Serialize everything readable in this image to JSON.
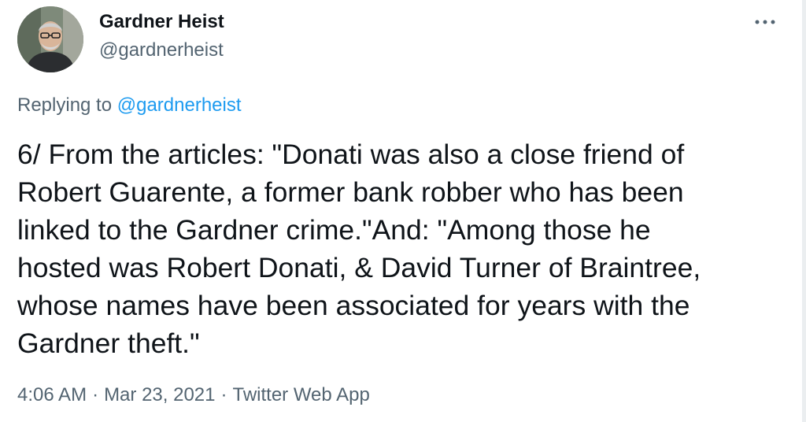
{
  "author": {
    "name": "Gardner Heist",
    "handle": "@gardnerheist",
    "avatar_icon": "profile-photo"
  },
  "more_icon": "more-horizontal-icon",
  "reply_context": {
    "prefix": "Replying to ",
    "mention": "@gardnerheist"
  },
  "tweet": {
    "lines": [
      "6/ From the articles: \"Donati was also a close friend of",
      "Robert Guarente, a former bank robber who has been",
      "linked to the Gardner crime.\"And: \"Among those he",
      "hosted was Robert Donati, & David Turner of Braintree,",
      "whose names have been associated for years with the",
      "Gardner theft.\""
    ]
  },
  "meta": {
    "time": "4:06 AM",
    "date": "Mar 23, 2021",
    "source": "Twitter Web App",
    "separator": "·"
  },
  "colors": {
    "text_primary": "#0f1419",
    "text_secondary": "#536471",
    "link": "#1d9bf0"
  }
}
